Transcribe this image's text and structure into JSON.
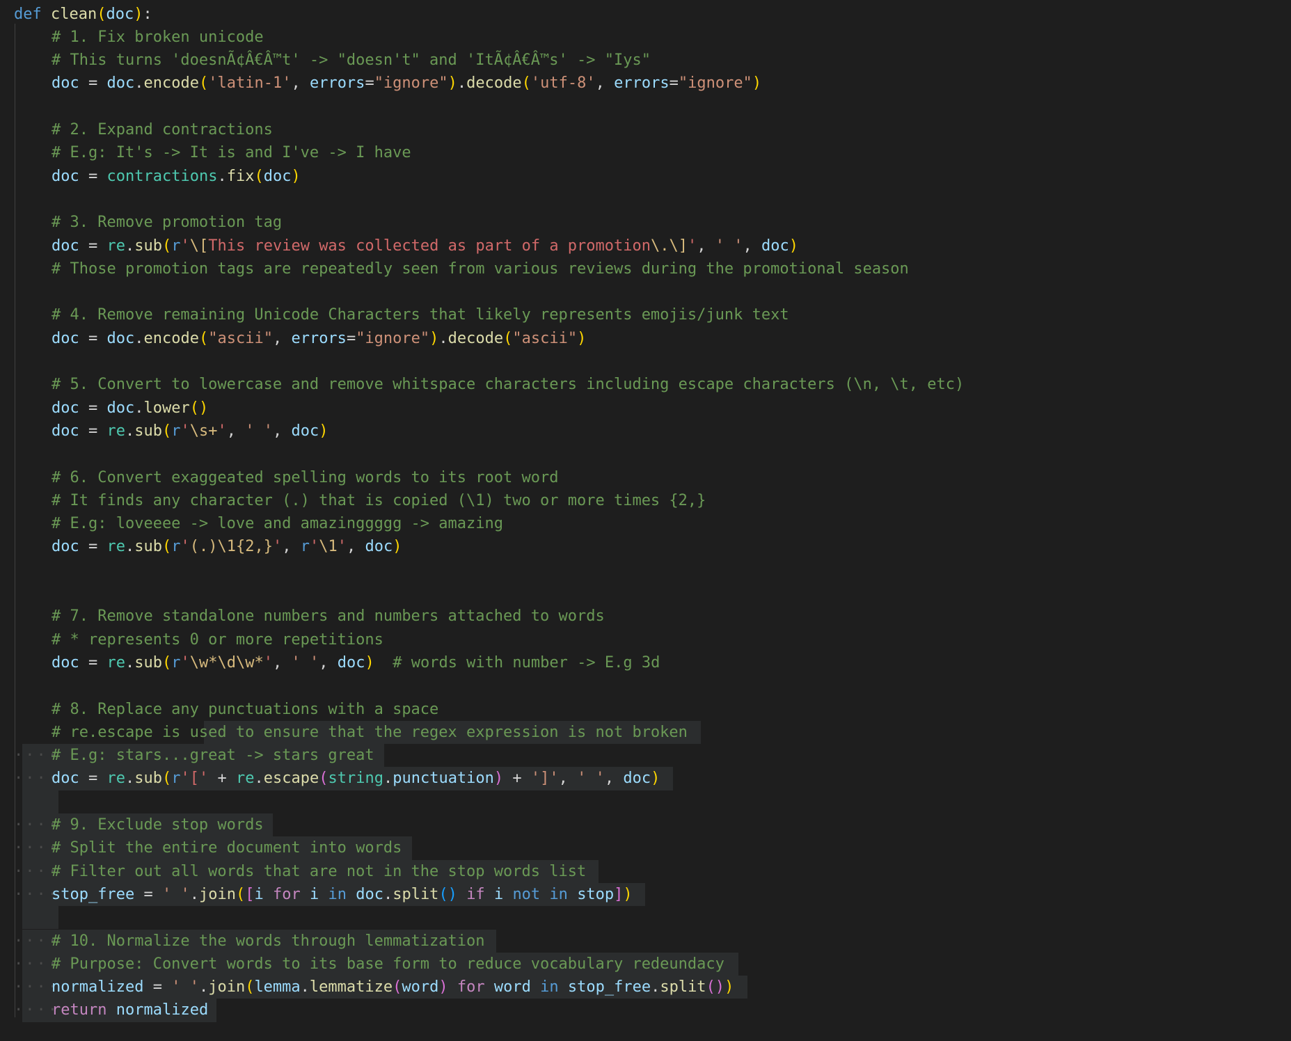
{
  "editor": {
    "colors": {
      "background": "#1e1e1e",
      "selection": "#2b2d2e",
      "keyword": "#569cd6",
      "control_keyword": "#c586c0",
      "function": "#dcdcaa",
      "variable": "#9cdcfe",
      "module": "#4ec9b0",
      "string": "#ce9178",
      "regex": "#d16969",
      "comment": "#6a9955"
    },
    "lines": [
      {
        "dots": "",
        "segs": [
          [
            "kw",
            "def"
          ],
          [
            "op",
            " "
          ],
          [
            "fn",
            "clean"
          ],
          [
            "p1",
            "("
          ],
          [
            "var",
            "doc"
          ],
          [
            "p1",
            ")"
          ],
          [
            "op",
            ":"
          ]
        ]
      },
      {
        "dots": "",
        "segs": [
          [
            "com",
            "# 1. Fix broken unicode"
          ]
        ]
      },
      {
        "dots": "",
        "segs": [
          [
            "com",
            "# This turns 'doesnÃ¢Â€Â™t' -> \"doesn't\" and 'ItÃ¢Â€Â™s' -> \"Iys\""
          ]
        ]
      },
      {
        "dots": "",
        "segs": [
          [
            "var",
            "doc"
          ],
          [
            "op",
            " = "
          ],
          [
            "var",
            "doc"
          ],
          [
            "op",
            "."
          ],
          [
            "fn",
            "encode"
          ],
          [
            "p1",
            "("
          ],
          [
            "str",
            "'latin-1'"
          ],
          [
            "op",
            ", "
          ],
          [
            "var",
            "errors"
          ],
          [
            "op",
            "="
          ],
          [
            "str",
            "\"ignore\""
          ],
          [
            "p1",
            ")"
          ],
          [
            "op",
            "."
          ],
          [
            "fn",
            "decode"
          ],
          [
            "p1",
            "("
          ],
          [
            "str",
            "'utf-8'"
          ],
          [
            "op",
            ", "
          ],
          [
            "var",
            "errors"
          ],
          [
            "op",
            "="
          ],
          [
            "str",
            "\"ignore\""
          ],
          [
            "p1",
            ")"
          ]
        ]
      },
      {
        "dots": "",
        "segs": []
      },
      {
        "dots": "",
        "segs": [
          [
            "com",
            "# 2. Expand contractions"
          ]
        ]
      },
      {
        "dots": "",
        "segs": [
          [
            "com",
            "# E.g: It's -> It is and I've -> I have"
          ]
        ]
      },
      {
        "dots": "",
        "segs": [
          [
            "var",
            "doc"
          ],
          [
            "op",
            " = "
          ],
          [
            "mod",
            "contractions"
          ],
          [
            "op",
            "."
          ],
          [
            "fn",
            "fix"
          ],
          [
            "p1",
            "("
          ],
          [
            "var",
            "doc"
          ],
          [
            "p1",
            ")"
          ]
        ]
      },
      {
        "dots": "",
        "segs": []
      },
      {
        "dots": "",
        "segs": [
          [
            "com",
            "# 3. Remove promotion tag"
          ]
        ]
      },
      {
        "dots": "",
        "segs": [
          [
            "var",
            "doc"
          ],
          [
            "op",
            " = "
          ],
          [
            "mod",
            "re"
          ],
          [
            "op",
            "."
          ],
          [
            "fn",
            "sub"
          ],
          [
            "p1",
            "("
          ],
          [
            "kw",
            "r"
          ],
          [
            "rx",
            "'"
          ],
          [
            "esc",
            "\\["
          ],
          [
            "rx",
            "This review was collected as part of a promotion"
          ],
          [
            "esc",
            "\\."
          ],
          [
            "esc",
            "\\]"
          ],
          [
            "rx",
            "'"
          ],
          [
            "op",
            ", "
          ],
          [
            "str",
            "' '"
          ],
          [
            "op",
            ", "
          ],
          [
            "var",
            "doc"
          ],
          [
            "p1",
            ")"
          ]
        ]
      },
      {
        "dots": "",
        "segs": [
          [
            "com",
            "# Those promotion tags are repeatedly seen from various reviews during the promotional season"
          ]
        ]
      },
      {
        "dots": "",
        "segs": []
      },
      {
        "dots": "",
        "segs": [
          [
            "com",
            "# 4. Remove remaining Unicode Characters that likely represents emojis/junk text"
          ]
        ]
      },
      {
        "dots": "",
        "segs": [
          [
            "var",
            "doc"
          ],
          [
            "op",
            " = "
          ],
          [
            "var",
            "doc"
          ],
          [
            "op",
            "."
          ],
          [
            "fn",
            "encode"
          ],
          [
            "p1",
            "("
          ],
          [
            "str",
            "\"ascii\""
          ],
          [
            "op",
            ", "
          ],
          [
            "var",
            "errors"
          ],
          [
            "op",
            "="
          ],
          [
            "str",
            "\"ignore\""
          ],
          [
            "p1",
            ")"
          ],
          [
            "op",
            "."
          ],
          [
            "fn",
            "decode"
          ],
          [
            "p1",
            "("
          ],
          [
            "str",
            "\"ascii\""
          ],
          [
            "p1",
            ")"
          ]
        ]
      },
      {
        "dots": "",
        "segs": []
      },
      {
        "dots": "",
        "segs": [
          [
            "com",
            "# 5. Convert to lowercase and remove whitspace characters including escape characters (\\n, \\t, etc)"
          ]
        ]
      },
      {
        "dots": "",
        "segs": [
          [
            "var",
            "doc"
          ],
          [
            "op",
            " = "
          ],
          [
            "var",
            "doc"
          ],
          [
            "op",
            "."
          ],
          [
            "fn",
            "lower"
          ],
          [
            "p1",
            "()"
          ]
        ]
      },
      {
        "dots": "",
        "segs": [
          [
            "var",
            "doc"
          ],
          [
            "op",
            " = "
          ],
          [
            "mod",
            "re"
          ],
          [
            "op",
            "."
          ],
          [
            "fn",
            "sub"
          ],
          [
            "p1",
            "("
          ],
          [
            "kw",
            "r"
          ],
          [
            "rx",
            "'"
          ],
          [
            "esc",
            "\\s+"
          ],
          [
            "rx",
            "'"
          ],
          [
            "op",
            ", "
          ],
          [
            "str",
            "' '"
          ],
          [
            "op",
            ", "
          ],
          [
            "var",
            "doc"
          ],
          [
            "p1",
            ")"
          ]
        ]
      },
      {
        "dots": "",
        "segs": []
      },
      {
        "dots": "",
        "segs": [
          [
            "com",
            "# 6. Convert exaggeated spelling words to its root word"
          ]
        ]
      },
      {
        "dots": "",
        "segs": [
          [
            "com",
            "# It finds any character (.) that is copied (\\1) two or more times {2,}"
          ]
        ]
      },
      {
        "dots": "",
        "segs": [
          [
            "com",
            "# E.g: loveeee -> love and amazinggggg -> amazing"
          ]
        ]
      },
      {
        "dots": "",
        "segs": [
          [
            "var",
            "doc"
          ],
          [
            "op",
            " = "
          ],
          [
            "mod",
            "re"
          ],
          [
            "op",
            "."
          ],
          [
            "fn",
            "sub"
          ],
          [
            "p1",
            "("
          ],
          [
            "kw",
            "r"
          ],
          [
            "rx",
            "'"
          ],
          [
            "esc",
            "(.)"
          ],
          [
            "esc",
            "\\1"
          ],
          [
            "esc",
            "{2,}"
          ],
          [
            "rx",
            "'"
          ],
          [
            "op",
            ", "
          ],
          [
            "kw",
            "r"
          ],
          [
            "rx",
            "'"
          ],
          [
            "esc",
            "\\1"
          ],
          [
            "rx",
            "'"
          ],
          [
            "op",
            ", "
          ],
          [
            "var",
            "doc"
          ],
          [
            "p1",
            ")"
          ]
        ]
      },
      {
        "dots": "",
        "segs": []
      },
      {
        "dots": "",
        "segs": []
      },
      {
        "dots": "",
        "segs": [
          [
            "com",
            "# 7. Remove standalone numbers and numbers attached to words"
          ]
        ]
      },
      {
        "dots": "",
        "segs": [
          [
            "com",
            "# * represents 0 or more repetitions"
          ]
        ]
      },
      {
        "dots": "",
        "segs": [
          [
            "var",
            "doc"
          ],
          [
            "op",
            " = "
          ],
          [
            "mod",
            "re"
          ],
          [
            "op",
            "."
          ],
          [
            "fn",
            "sub"
          ],
          [
            "p1",
            "("
          ],
          [
            "kw",
            "r"
          ],
          [
            "rx",
            "'"
          ],
          [
            "esc",
            "\\w*\\d\\w*"
          ],
          [
            "rx",
            "'"
          ],
          [
            "op",
            ", "
          ],
          [
            "str",
            "' '"
          ],
          [
            "op",
            ", "
          ],
          [
            "var",
            "doc"
          ],
          [
            "p1",
            ")"
          ],
          [
            "op",
            "  "
          ],
          [
            "com",
            "# words with number -> E.g 3d"
          ]
        ]
      },
      {
        "dots": "",
        "segs": []
      },
      {
        "dots": "",
        "segs": [
          [
            "com",
            "# 8. Replace any punctuations with a space"
          ]
        ]
      },
      {
        "dots": "",
        "segs": [
          [
            "com",
            "# re.escape is used to ensure that the regex expression is not broken"
          ]
        ]
      },
      {
        "dots": "····",
        "segs": [
          [
            "com",
            "# E.g: stars...great -> stars great"
          ]
        ]
      },
      {
        "dots": "····",
        "segs": [
          [
            "var",
            "doc"
          ],
          [
            "op",
            " = "
          ],
          [
            "mod",
            "re"
          ],
          [
            "op",
            "."
          ],
          [
            "fn",
            "sub"
          ],
          [
            "p1",
            "("
          ],
          [
            "kw",
            "r"
          ],
          [
            "rx",
            "'['"
          ],
          [
            "op",
            " + "
          ],
          [
            "mod",
            "re"
          ],
          [
            "op",
            "."
          ],
          [
            "fn",
            "escape"
          ],
          [
            "p2",
            "("
          ],
          [
            "mod",
            "string"
          ],
          [
            "op",
            "."
          ],
          [
            "var",
            "punctuation"
          ],
          [
            "p2",
            ")"
          ],
          [
            "op",
            " + "
          ],
          [
            "str",
            "']'"
          ],
          [
            "op",
            ", "
          ],
          [
            "str",
            "' '"
          ],
          [
            "op",
            ", "
          ],
          [
            "var",
            "doc"
          ],
          [
            "p1",
            ")"
          ]
        ]
      },
      {
        "dots": "",
        "segs": []
      },
      {
        "dots": "····",
        "segs": [
          [
            "com",
            "# 9. Exclude stop words"
          ]
        ]
      },
      {
        "dots": "····",
        "segs": [
          [
            "com",
            "# Split the entire document into words"
          ]
        ]
      },
      {
        "dots": "····",
        "segs": [
          [
            "com",
            "# Filter out all words that are not in the stop words list"
          ]
        ]
      },
      {
        "dots": "····",
        "segs": [
          [
            "var",
            "stop_free"
          ],
          [
            "op",
            " = "
          ],
          [
            "str",
            "' '"
          ],
          [
            "op",
            "."
          ],
          [
            "fn",
            "join"
          ],
          [
            "p1",
            "("
          ],
          [
            "p2",
            "["
          ],
          [
            "var",
            "i"
          ],
          [
            "op",
            " "
          ],
          [
            "kw2",
            "for"
          ],
          [
            "op",
            " "
          ],
          [
            "var",
            "i"
          ],
          [
            "op",
            " "
          ],
          [
            "kw",
            "in"
          ],
          [
            "op",
            " "
          ],
          [
            "var",
            "doc"
          ],
          [
            "op",
            "."
          ],
          [
            "fn",
            "split"
          ],
          [
            "p3",
            "()"
          ],
          [
            "op",
            " "
          ],
          [
            "kw2",
            "if"
          ],
          [
            "op",
            " "
          ],
          [
            "var",
            "i"
          ],
          [
            "op",
            " "
          ],
          [
            "kw",
            "not"
          ],
          [
            "op",
            " "
          ],
          [
            "kw",
            "in"
          ],
          [
            "op",
            " "
          ],
          [
            "var",
            "stop"
          ],
          [
            "p2",
            "]"
          ],
          [
            "p1",
            ")"
          ]
        ]
      },
      {
        "dots": "",
        "segs": []
      },
      {
        "dots": "····",
        "segs": [
          [
            "com",
            "# 10. Normalize the words through lemmatization"
          ]
        ]
      },
      {
        "dots": "····",
        "segs": [
          [
            "com",
            "# Purpose: Convert words to its base form to reduce vocabulary redeundacy"
          ]
        ]
      },
      {
        "dots": "····",
        "segs": [
          [
            "var",
            "normalized"
          ],
          [
            "op",
            " = "
          ],
          [
            "str",
            "' '"
          ],
          [
            "op",
            "."
          ],
          [
            "fn",
            "join"
          ],
          [
            "p1",
            "("
          ],
          [
            "var",
            "lemma"
          ],
          [
            "op",
            "."
          ],
          [
            "fn",
            "lemmatize"
          ],
          [
            "p2",
            "("
          ],
          [
            "var",
            "word"
          ],
          [
            "p2",
            ")"
          ],
          [
            "op",
            " "
          ],
          [
            "kw2",
            "for"
          ],
          [
            "op",
            " "
          ],
          [
            "var",
            "word"
          ],
          [
            "op",
            " "
          ],
          [
            "kw",
            "in"
          ],
          [
            "op",
            " "
          ],
          [
            "var",
            "stop_free"
          ],
          [
            "op",
            "."
          ],
          [
            "fn",
            "split"
          ],
          [
            "p2",
            "()"
          ],
          [
            "p1",
            ")"
          ]
        ]
      },
      {
        "dots": "····",
        "segs": [
          [
            "kw2",
            "return"
          ],
          [
            "op",
            " "
          ],
          [
            "var",
            "normalized"
          ]
        ]
      }
    ]
  }
}
